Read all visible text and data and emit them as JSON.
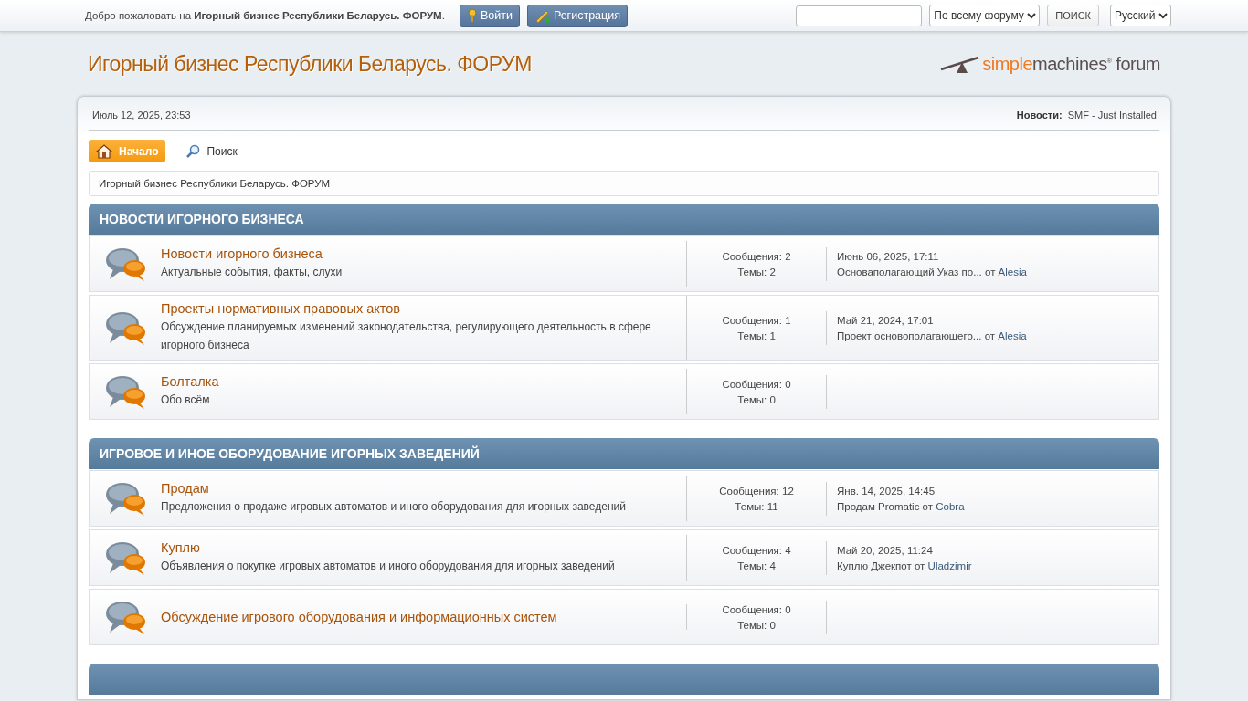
{
  "top_bar": {
    "welcome_prefix": "Добро пожаловать на",
    "welcome_site": "Игорный бизнес Республики Беларусь. ФОРУМ",
    "welcome_suffix": ".",
    "login_button": "Войти",
    "register_button": "Регистрация",
    "search_scope": "По всему форуму",
    "search_button": "ПОИСК",
    "language": "Русский"
  },
  "header": {
    "forum_title": "Игорный бизнес Республики Беларусь. ФОРУМ",
    "logo_part1": "simple",
    "logo_part2": "machines",
    "logo_mark": "®",
    "logo_part3": "forum"
  },
  "info_bar": {
    "date": "Июль 12, 2025, 23:53",
    "news_label": "Новости:",
    "news_text": "SMF - Just Installed!"
  },
  "menu": [
    {
      "label": "Начало",
      "kind": "home",
      "selected": true
    },
    {
      "label": "Поиск",
      "kind": "search",
      "selected": false
    }
  ],
  "breadcrumb": "Игорный бизнес Республики Беларусь. ФОРУМ",
  "categories": [
    {
      "title": "НОВОСТИ ИГОРНОГО БИЗНЕСА",
      "boards": [
        {
          "name": "Новости игорного бизнеса",
          "description": "Актуальные события, факты, слухи",
          "posts_label": "Сообщения:",
          "posts": "2",
          "topics_label": "Темы:",
          "topics": "2",
          "last_post": {
            "date": "Июнь 06, 2025, 17:11",
            "topic": "Основаполагающий Указ по...",
            "by": "от",
            "author": "Alesia"
          }
        },
        {
          "name": "Проекты нормативных правовых актов",
          "description": "Обсуждение планируемых изменений законодательства, регулирующего деятельность в сфере игорного бизнеса",
          "posts_label": "Сообщения:",
          "posts": "1",
          "topics_label": "Темы:",
          "topics": "1",
          "last_post": {
            "date": "Май 21, 2024, 17:01",
            "topic": "Проект основополагающего...",
            "by": "от",
            "author": "Alesia"
          }
        },
        {
          "name": "Болталка",
          "description": "Обо всём",
          "posts_label": "Сообщения:",
          "posts": "0",
          "topics_label": "Темы:",
          "topics": "0"
        }
      ]
    },
    {
      "title": "ИГРОВОЕ И ИНОЕ ОБОРУДОВАНИЕ ИГОРНЫХ ЗАВЕДЕНИЙ",
      "boards": [
        {
          "name": "Продам",
          "description": "Предложения о продаже игровых автоматов и иного оборудования для игорных заведений",
          "posts_label": "Сообщения:",
          "posts": "12",
          "topics_label": "Темы:",
          "topics": "11",
          "last_post": {
            "date": "Янв. 14, 2025, 14:45",
            "topic": "Продам Promatic",
            "by": "от",
            "author": "Cobra"
          }
        },
        {
          "name": "Куплю",
          "description": "Объявления о покупке игровых автоматов и иного оборудования для игорных заведений",
          "posts_label": "Сообщения:",
          "posts": "4",
          "topics_label": "Темы:",
          "topics": "4",
          "last_post": {
            "date": "Май 20, 2025, 11:24",
            "topic": "Куплю Джекпот",
            "by": "от",
            "author": "Uladzimir"
          }
        },
        {
          "name": "Обсуждение игрового оборудования и информационных систем",
          "posts_label": "Сообщения:",
          "posts": "0",
          "topics_label": "Темы:",
          "topics": "0"
        }
      ]
    }
  ]
}
